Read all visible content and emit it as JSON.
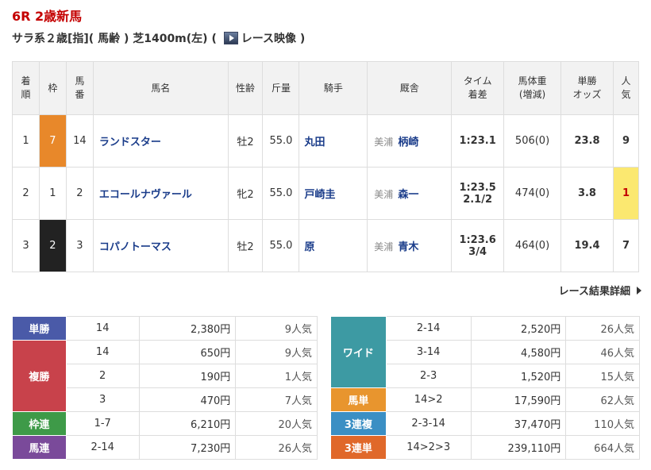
{
  "race": {
    "title": "6R 2歳新馬",
    "subtitle_pre": "サラ系２歳[指]( 馬齢 ) 芝1400m(左)  (",
    "video_label": "レース映像",
    "subtitle_post": ")"
  },
  "headers": {
    "rank": [
      "着",
      "順"
    ],
    "waku": "枠",
    "umaban": [
      "馬",
      "番"
    ],
    "horse": "馬名",
    "sexage": "性齢",
    "weight": "斤量",
    "jockey": "騎手",
    "trainer": "厩舎",
    "time": [
      "タイム",
      "着差"
    ],
    "body": [
      "馬体重",
      "(増減)"
    ],
    "odds": [
      "単勝",
      "オッズ"
    ],
    "pop": [
      "人",
      "気"
    ]
  },
  "rows": [
    {
      "rank": "1",
      "waku": "7",
      "umaban": "14",
      "horse": "ランドスター",
      "sexage": "牡2",
      "weight": "55.0",
      "jockey": "丸田",
      "region": "美浦",
      "trainer": "柄崎",
      "time": "1:23.1",
      "margin": "",
      "body": "506(0)",
      "odds": "23.8",
      "pop": "9"
    },
    {
      "rank": "2",
      "waku": "1",
      "umaban": "2",
      "horse": "エコールナヴァール",
      "sexage": "牝2",
      "weight": "55.0",
      "jockey": "戸崎圭",
      "region": "美浦",
      "trainer": "森一",
      "time": "1:23.5",
      "margin": "2.1/2",
      "body": "474(0)",
      "odds": "3.8",
      "pop": "1"
    },
    {
      "rank": "3",
      "waku": "2",
      "umaban": "3",
      "horse": "コパノトーマス",
      "sexage": "牡2",
      "weight": "55.0",
      "jockey": "原",
      "region": "美浦",
      "trainer": "青木",
      "time": "1:23.6",
      "margin": "3/4",
      "body": "464(0)",
      "odds": "19.4",
      "pop": "7"
    }
  ],
  "detail_link": "レース結果詳細",
  "colors": {
    "tansho": "#4a5aa8",
    "fukusho": "#c8424b",
    "wakuren": "#3e9a48",
    "umaren": "#7a4a9a",
    "wide": "#3d9aa3",
    "umatan": "#e8952e",
    "sanrenpuku": "#3b8fc4",
    "sanrentan": "#e0682a"
  },
  "payout_left": {
    "tansho": {
      "label": "単勝",
      "combo": "14",
      "yen": "2,380円",
      "pop": "9人気"
    },
    "fukusho": {
      "label": "複勝",
      "items": [
        {
          "combo": "14",
          "yen": "650円",
          "pop": "9人気"
        },
        {
          "combo": "2",
          "yen": "190円",
          "pop": "1人気"
        },
        {
          "combo": "3",
          "yen": "470円",
          "pop": "7人気"
        }
      ]
    },
    "wakuren": {
      "label": "枠連",
      "combo": "1-7",
      "yen": "6,210円",
      "pop": "20人気"
    },
    "umaren": {
      "label": "馬連",
      "combo": "2-14",
      "yen": "7,230円",
      "pop": "26人気"
    }
  },
  "payout_right": {
    "wide": {
      "label": "ワイド",
      "items": [
        {
          "combo": "2-14",
          "yen": "2,520円",
          "pop": "26人気"
        },
        {
          "combo": "3-14",
          "yen": "4,580円",
          "pop": "46人気"
        },
        {
          "combo": "2-3",
          "yen": "1,520円",
          "pop": "15人気"
        }
      ]
    },
    "umatan": {
      "label": "馬単",
      "combo": "14>2",
      "yen": "17,590円",
      "pop": "62人気"
    },
    "sanrenpuku": {
      "label": "3連複",
      "combo": "2-3-14",
      "yen": "37,470円",
      "pop": "110人気"
    },
    "sanrentan": {
      "label": "3連単",
      "combo": "14>2>3",
      "yen": "239,110円",
      "pop": "664人気"
    }
  }
}
